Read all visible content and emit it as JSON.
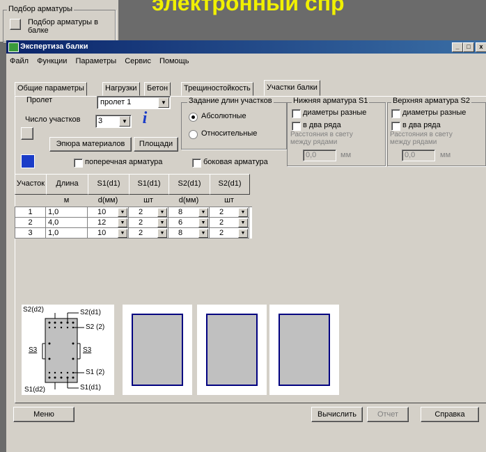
{
  "background": {
    "slide_title": "электронный спр",
    "group_label": "Подбор арматуры",
    "item_label": "Подбор арматуры в балке"
  },
  "window": {
    "title": "Экспертиза балки",
    "title_color": "#0a246a",
    "controls": [
      "_",
      "□",
      "x"
    ]
  },
  "menu": [
    "Файл",
    "Функции",
    "Параметры",
    "Сервис",
    "Помощь"
  ],
  "tabs": [
    "Общие параметры",
    "Нагрузки",
    "Бетон",
    "Трещиностойкость",
    "Участки балки"
  ],
  "active_tab": "Участки балки",
  "span": {
    "label": "Пролет",
    "value": "пролет 1"
  },
  "count": {
    "label": "Число участков",
    "value": "3"
  },
  "buttons": {
    "epure": "Эпюра материалов",
    "areas": "Площади",
    "menu": "Меню",
    "compute": "Вычислить",
    "report": "Отчет",
    "help": "Справка"
  },
  "length_mode": {
    "label": "Задание длин участков",
    "absolute": "Абсолютные",
    "relative": "Относительные",
    "selected": "absolute"
  },
  "bottom_rebar": {
    "label": "Нижняя арматура S1",
    "diff_diam": "диаметры разные",
    "two_rows": "в два ряда",
    "gap_label_1": "Расстояния в свету",
    "gap_label_2": "между рядами",
    "gap_value": "0,0",
    "gap_unit": "мм"
  },
  "top_rebar": {
    "label": "Верхняя арматура S2",
    "diff_diam": "диаметры разные",
    "two_rows": "в два ряда",
    "gap_label_1": "Расстояния в свету",
    "gap_label_2": "между рядами",
    "gap_value": "0,0",
    "gap_unit": "мм"
  },
  "cross_rebar": "поперечная арматура",
  "side_rebar": "боковая арматура",
  "table": {
    "headers": [
      "Участок",
      "Длина",
      "S1(d1)",
      "S1(d1)",
      "S2(d1)",
      "S2(d1)"
    ],
    "units": [
      "",
      "м",
      "d(мм)",
      "шт",
      "d(мм)",
      "шт"
    ],
    "rows": [
      [
        "1",
        "1,0",
        "10",
        "2",
        "8",
        "2"
      ],
      [
        "2",
        "4,0",
        "12",
        "2",
        "6",
        "2"
      ],
      [
        "3",
        "1,0",
        "10",
        "2",
        "8",
        "2"
      ]
    ]
  },
  "diagram": {
    "s2d2": "S2(d2)",
    "s2d1": "S2(d1)",
    "s2_2": "S2 (2)",
    "s3_left": "S3",
    "s3_right": "S3",
    "s1_2": "S1 (2)",
    "s1d2": "S1(d2)",
    "s1d1": "S1(d1)"
  },
  "section_color": "#000080",
  "section_fill": "#c0c0c0"
}
